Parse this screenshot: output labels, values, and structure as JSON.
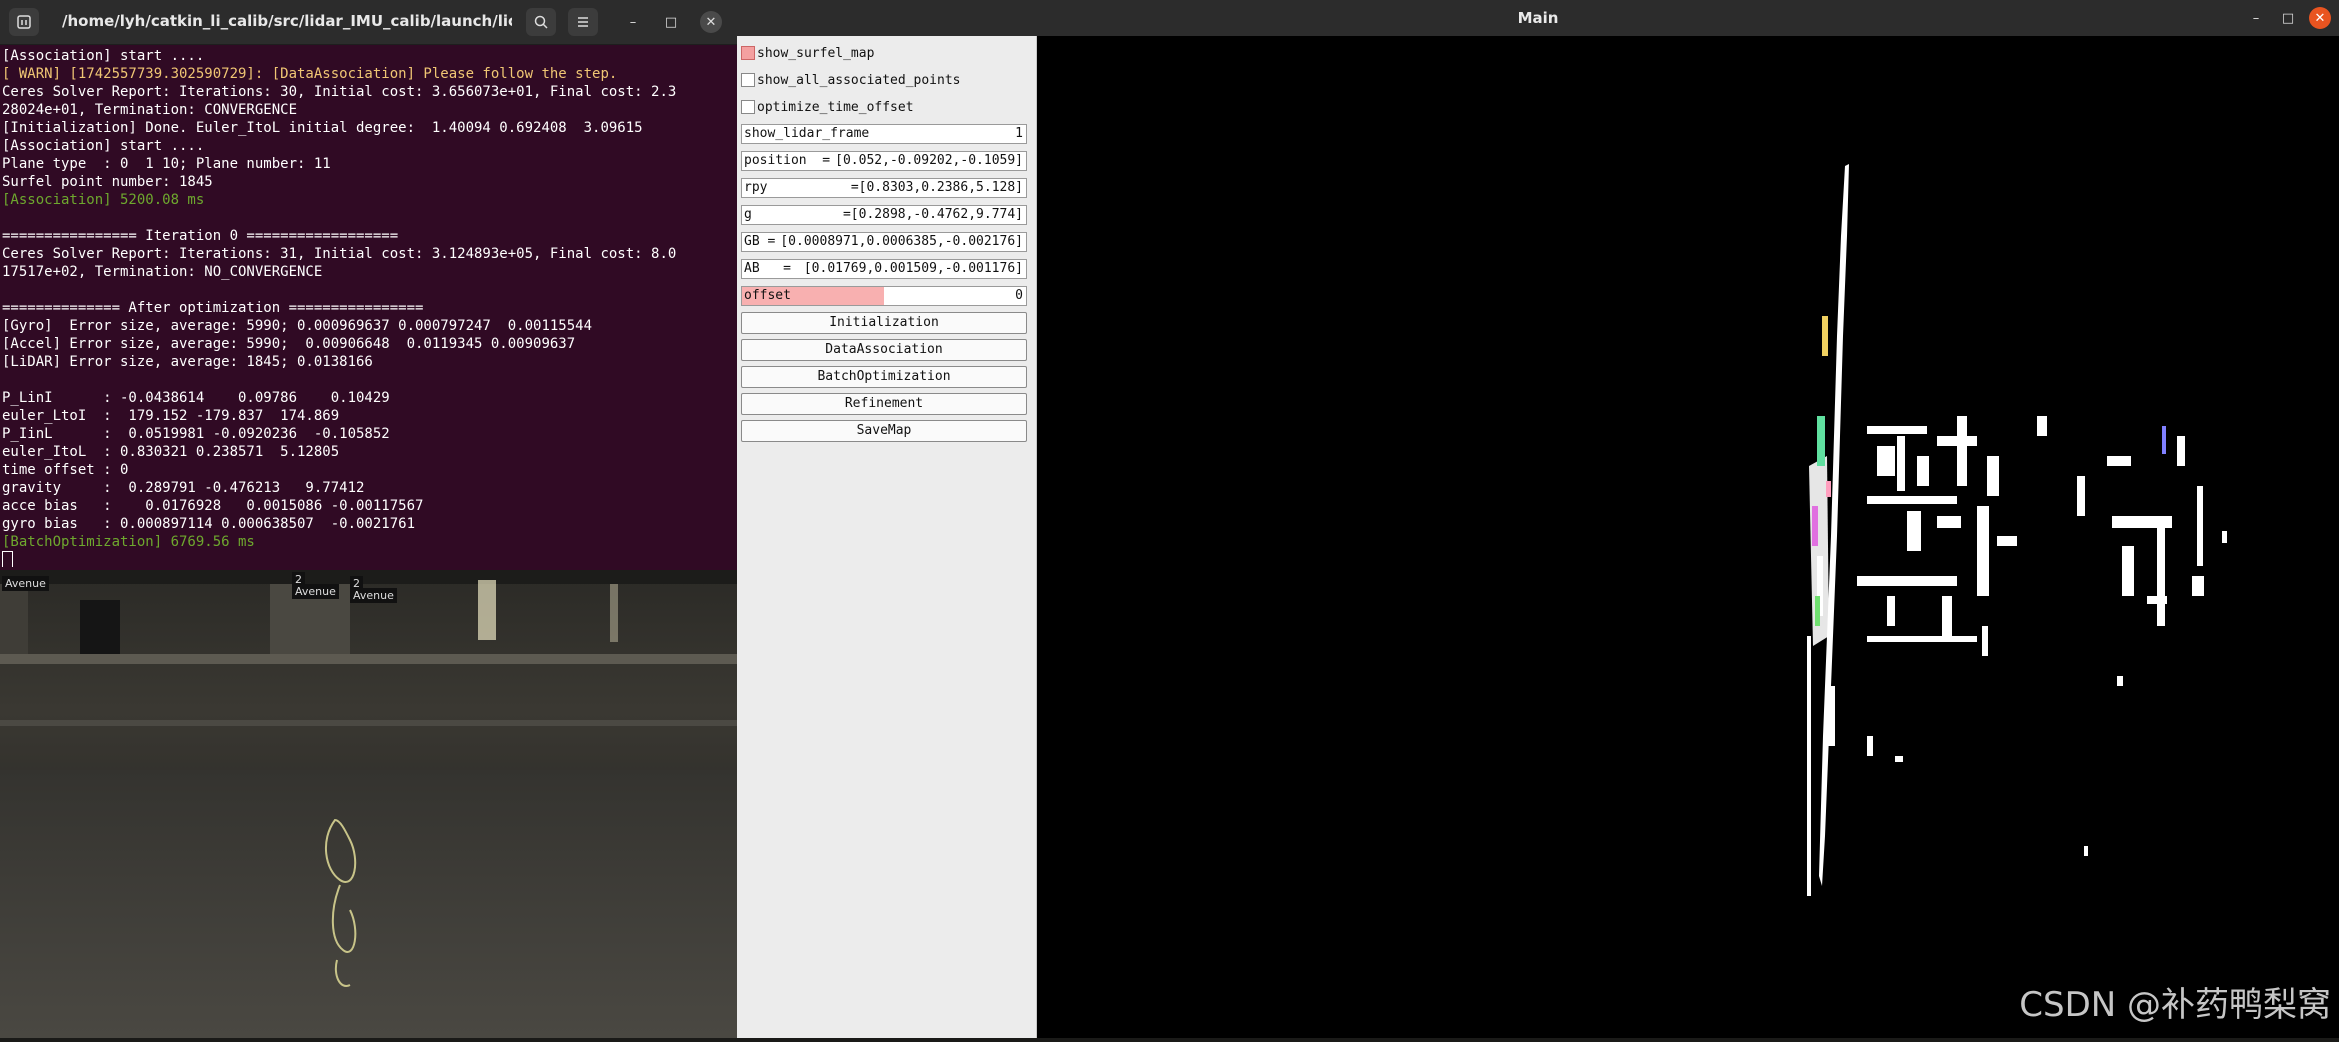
{
  "terminal": {
    "title": "/home/lyh/catkin_li_calib/src/lidar_IMU_calib/launch/licalib_...",
    "icons": {
      "new_tab": "terminal-icon",
      "search": "search-icon",
      "menu": "hamburger-icon",
      "minimize": "minimize-icon",
      "maximize": "maximize-icon",
      "close": "close-icon"
    },
    "lines": [
      {
        "text": "[Association] start ....",
        "style": "normal"
      },
      {
        "text": "[ WARN] [1742557739.302590729]: [DataAssociation] Please follow the step.",
        "style": "warn"
      },
      {
        "text": "Ceres Solver Report: Iterations: 30, Initial cost: 3.656073e+01, Final cost: 2.3",
        "style": "normal"
      },
      {
        "text": "28024e+01, Termination: CONVERGENCE",
        "style": "normal"
      },
      {
        "text": "[Initialization] Done. Euler_ItoL initial degree:  1.40094 0.692408  3.09615",
        "style": "normal"
      },
      {
        "text": "[Association] start ....",
        "style": "normal"
      },
      {
        "text": "Plane type  : 0  1 10; Plane number: 11",
        "style": "normal"
      },
      {
        "text": "Surfel point number: 1845",
        "style": "normal"
      },
      {
        "text": "[Association] 5200.08 ms",
        "style": "green"
      },
      {
        "text": "",
        "style": "normal"
      },
      {
        "text": "================ Iteration 0 ==================",
        "style": "normal"
      },
      {
        "text": "Ceres Solver Report: Iterations: 31, Initial cost: 3.124893e+05, Final cost: 8.0",
        "style": "normal"
      },
      {
        "text": "17517e+02, Termination: NO_CONVERGENCE",
        "style": "normal"
      },
      {
        "text": "",
        "style": "normal"
      },
      {
        "text": "============== After optimization ================",
        "style": "normal"
      },
      {
        "text": "[Gyro]  Error size, average: 5990; 0.000969637 0.000797247  0.00115544",
        "style": "normal"
      },
      {
        "text": "[Accel] Error size, average: 5990;  0.00906648  0.0119345 0.00909637",
        "style": "normal"
      },
      {
        "text": "[LiDAR] Error size, average: 1845; 0.0138166",
        "style": "normal"
      },
      {
        "text": "",
        "style": "normal"
      },
      {
        "text": "P_LinI      : -0.0438614    0.09786    0.10429",
        "style": "normal"
      },
      {
        "text": "euler_LtoI  :  179.152 -179.837  174.869",
        "style": "normal"
      },
      {
        "text": "P_IinL      :  0.0519981 -0.0920236  -0.105852",
        "style": "normal"
      },
      {
        "text": "euler_ItoL  : 0.830321 0.238571  5.12805",
        "style": "normal"
      },
      {
        "text": "time offset : 0",
        "style": "normal"
      },
      {
        "text": "gravity     :  0.289791 -0.476213   9.77412",
        "style": "normal"
      },
      {
        "text": "acce bias   :    0.0176928   0.0015086 -0.00117567",
        "style": "normal"
      },
      {
        "text": "gyro bias   : 0.000897114 0.000638507  -0.0021761",
        "style": "normal"
      },
      {
        "text": "[BatchOptimization] 6769.56 ms",
        "style": "green"
      }
    ]
  },
  "background": {
    "signs": [
      "Avenue",
      "2",
      "Avenue",
      "2",
      "Avenue"
    ]
  },
  "main": {
    "title": "Main",
    "panel": {
      "checkboxes": [
        {
          "label": "show_surfel_map",
          "checked": true
        },
        {
          "label": "show_all_associated_points",
          "checked": false
        },
        {
          "label": "optimize_time_offset",
          "checked": false
        }
      ],
      "vars": [
        {
          "label": "show_lidar_frame",
          "value": "1"
        },
        {
          "label": "position  =",
          "value": "[0.052,-0.09202,-0.1059]"
        },
        {
          "label": "rpy",
          "value": "=[0.8303,0.2386,5.128]"
        },
        {
          "label": "g",
          "value": "=[0.2898,-0.4762,9.774]"
        },
        {
          "label": "GB =",
          "value": "[0.0008971,0.0006385,-0.002176]"
        },
        {
          "label": "AB   =",
          "value": "[0.01769,0.001509,-0.001176]"
        }
      ],
      "slider": {
        "label": "offset",
        "value": "0",
        "fill_fraction": 0.5
      },
      "buttons": [
        "Initialization",
        "DataAssociation",
        "BatchOptimization",
        "Refinement",
        "SaveMap"
      ]
    },
    "watermark": "CSDN @补药鸭梨窝"
  }
}
